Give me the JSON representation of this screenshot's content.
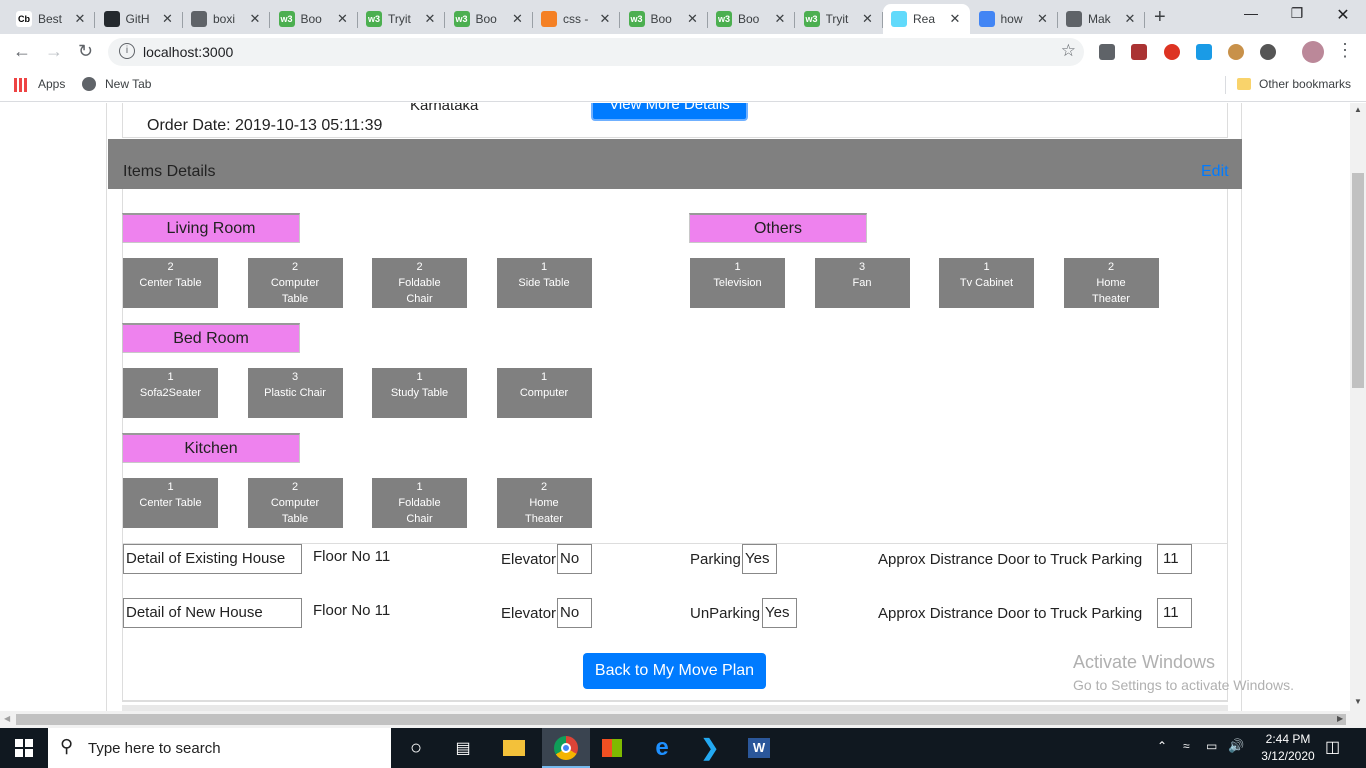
{
  "browser": {
    "tabs": [
      {
        "title": "Best",
        "icon": "cb-icon",
        "color": "#ffffff"
      },
      {
        "title": "GitH",
        "icon": "github-icon",
        "color": "#24292e"
      },
      {
        "title": "boxi",
        "icon": "globe-icon",
        "color": "#5f6368"
      },
      {
        "title": "Boo",
        "icon": "w3-icon",
        "color": "#4caf50"
      },
      {
        "title": "Tryit",
        "icon": "w3-icon",
        "color": "#4caf50"
      },
      {
        "title": "Boo",
        "icon": "w3-icon",
        "color": "#4caf50"
      },
      {
        "title": "css -",
        "icon": "stackoverflow-icon",
        "color": "#f48024"
      },
      {
        "title": "Boo",
        "icon": "w3-icon",
        "color": "#4caf50"
      },
      {
        "title": "Boo",
        "icon": "w3-icon",
        "color": "#4caf50"
      },
      {
        "title": "Tryit",
        "icon": "w3-icon",
        "color": "#4caf50"
      },
      {
        "title": "Rea",
        "icon": "react-icon",
        "color": "#61dafb"
      },
      {
        "title": "how",
        "icon": "google-icon",
        "color": "#4285f4"
      },
      {
        "title": "Mak",
        "icon": "doc-icon",
        "color": "#5f6368"
      }
    ],
    "url": "localhost:3000",
    "bookmarks": {
      "apps": "Apps",
      "new_tab": "New Tab",
      "other": "Other bookmarks"
    }
  },
  "page": {
    "top_state": "Karnataka",
    "order_date": "Order Date: 2019-10-13 05:11:39",
    "view_more_button": "View More Details",
    "items_details_title": "Items Details",
    "edit_link": "Edit",
    "rooms": [
      {
        "name": "Living Room",
        "items": [
          {
            "qty": "2",
            "name": "Center Table"
          },
          {
            "qty": "2",
            "name": "Computer Table"
          },
          {
            "qty": "2",
            "name": "Foldable Chair"
          },
          {
            "qty": "1",
            "name": "Side Table"
          }
        ]
      },
      {
        "name": "Bed Room",
        "items": [
          {
            "qty": "1",
            "name": "Sofa2Seater"
          },
          {
            "qty": "3",
            "name": "Plastic Chair"
          },
          {
            "qty": "1",
            "name": "Study Table"
          },
          {
            "qty": "1",
            "name": "Computer"
          }
        ]
      },
      {
        "name": "Kitchen",
        "items": [
          {
            "qty": "1",
            "name": "Center Table"
          },
          {
            "qty": "2",
            "name": "Computer Table"
          },
          {
            "qty": "1",
            "name": "Foldable Chair"
          },
          {
            "qty": "2",
            "name": "Home Theater"
          }
        ]
      },
      {
        "name": "Others",
        "items": [
          {
            "qty": "1",
            "name": "Television"
          },
          {
            "qty": "3",
            "name": "Fan"
          },
          {
            "qty": "1",
            "name": "Tv Cabinet"
          },
          {
            "qty": "2",
            "name": "Home Theater"
          }
        ]
      }
    ],
    "existing_house": {
      "label": "Detail of Existing House",
      "floor": "Floor No 11",
      "elevator_label": "Elevator",
      "elevator_value": "No",
      "parking_label": "Parking",
      "parking_value": "Yes",
      "distance_label": "Approx Distrance Door to Truck Parking",
      "distance_value": "11"
    },
    "new_house": {
      "label": "Detail of New House",
      "floor": "Floor No 11",
      "elevator_label": "Elevator",
      "elevator_value": "No",
      "parking_label": "UnParking",
      "parking_value": "Yes",
      "distance_label": "Approx Distrance Door to Truck Parking",
      "distance_value": "11"
    },
    "back_button": "Back to My Move Plan",
    "watermark_title": "Activate Windows",
    "watermark_sub": "Go to Settings to activate Windows."
  },
  "taskbar": {
    "search_placeholder": "Type here to search",
    "time": "2:44 PM",
    "date": "3/12/2020"
  }
}
